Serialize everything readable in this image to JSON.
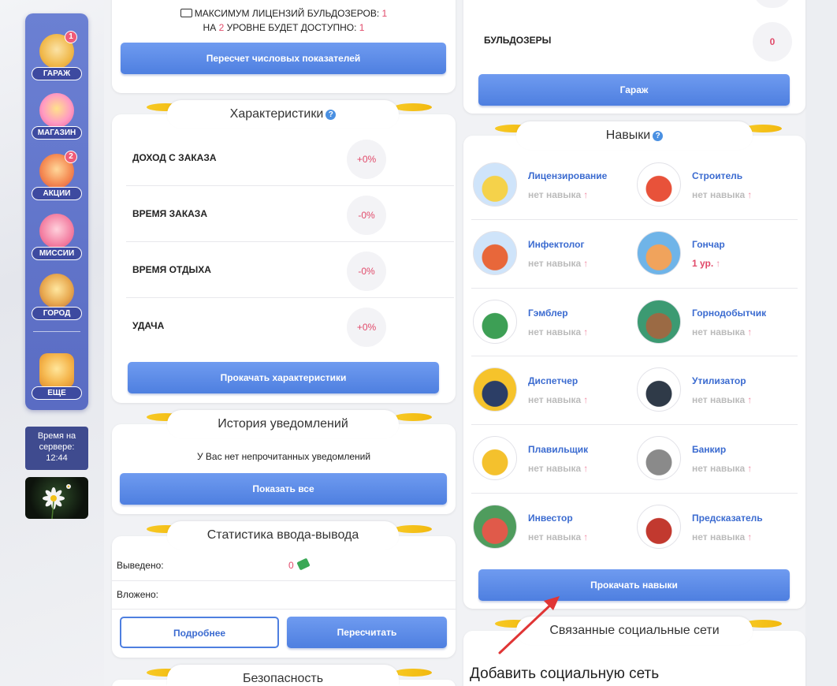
{
  "sidebar": {
    "items": [
      {
        "label": "Гараж",
        "badge": "1"
      },
      {
        "label": "Магазин",
        "badge": ""
      },
      {
        "label": "Акции",
        "badge": "2"
      },
      {
        "label": "Миссии",
        "badge": ""
      },
      {
        "label": "Город",
        "badge": ""
      },
      {
        "label": "Еще",
        "badge": ""
      }
    ],
    "server_time_label": "Время на сервере:",
    "server_time": "12:44"
  },
  "license": {
    "line1_prefix": "МАКСИМУМ ЛИЦЕНЗИЙ БУЛЬДОЗЕРОВ:",
    "line1_value": "1",
    "line2_prefix": "НА",
    "line2_level": "2",
    "line2_suffix": "УРОВНЕ БУДЕТ ДОСТУПНО:",
    "line2_value": "1",
    "button": "Пересчет числовых показателей"
  },
  "characteristics": {
    "title": "Характеристики",
    "help": "?",
    "rows": [
      {
        "label": "ДОХОД С ЗАКАЗА",
        "value": "+0%"
      },
      {
        "label": "ВРЕМЯ ЗАКАЗА",
        "value": "-0%"
      },
      {
        "label": "ВРЕМЯ ОТДЫХА",
        "value": "-0%"
      },
      {
        "label": "УДАЧА",
        "value": "+0%"
      }
    ],
    "button": "Прокачать характеристики"
  },
  "notifications": {
    "title": "История уведомлений",
    "message": "У Вас нет непрочитанных уведомлений",
    "button": "Показать все"
  },
  "io_stats": {
    "title": "Статистика ввода-вывода",
    "withdrawn_label": "Выведено:",
    "withdrawn_value": "0",
    "deposited_label": "Вложено:",
    "details_button": "Подробнее",
    "recalc_button": "Пересчитать"
  },
  "security": {
    "title": "Безопасность"
  },
  "garage_box": {
    "bulldozers_label": "БУЛЬДОЗЕРЫ",
    "bulldozers_value": "0",
    "button": "Гараж"
  },
  "skills": {
    "title": "Навыки",
    "help": "?",
    "items": [
      {
        "name": "Лицензирование",
        "level": "нет навыка",
        "has": false
      },
      {
        "name": "Строитель",
        "level": "нет навыка",
        "has": false
      },
      {
        "name": "Инфектолог",
        "level": "нет навыка",
        "has": false
      },
      {
        "name": "Гончар",
        "level": "1 ур.",
        "has": true
      },
      {
        "name": "Гэмблер",
        "level": "нет навыка",
        "has": false
      },
      {
        "name": "Горнодобытчик",
        "level": "нет навыка",
        "has": false
      },
      {
        "name": "Диспетчер",
        "level": "нет навыка",
        "has": false
      },
      {
        "name": "Утилизатор",
        "level": "нет навыка",
        "has": false
      },
      {
        "name": "Плавильщик",
        "level": "нет навыка",
        "has": false
      },
      {
        "name": "Банкир",
        "level": "нет навыка",
        "has": false
      },
      {
        "name": "Инвестор",
        "level": "нет навыка",
        "has": false
      },
      {
        "name": "Предсказатель",
        "level": "нет навыка",
        "has": false
      }
    ],
    "arrow": "↑",
    "button": "Прокачать навыки"
  },
  "social": {
    "title": "Связанные социальные сети",
    "add_text": "Добавить социальную сеть"
  },
  "colors": {
    "accent": "#4e7fe0",
    "pink": "#e14a6a",
    "sidebar": "#5a6cc3"
  }
}
